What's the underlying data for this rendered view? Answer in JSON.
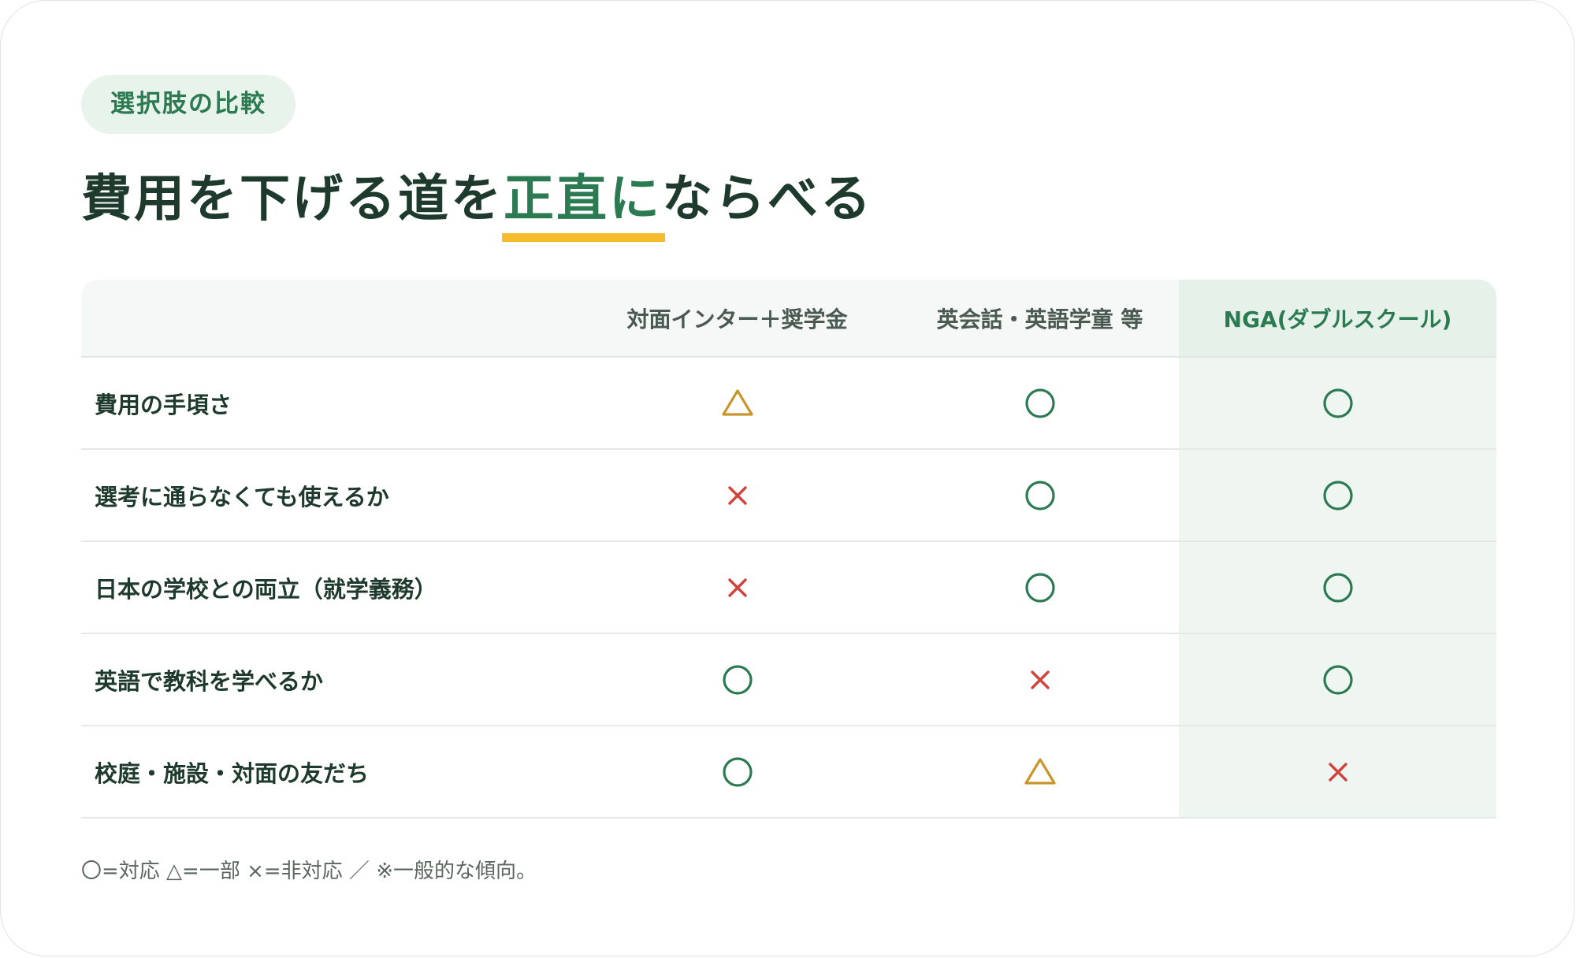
{
  "badge": "選択肢の比較",
  "title": {
    "before": "費用を下げる道を",
    "highlight": "正直に",
    "after": "ならべる"
  },
  "table": {
    "columns": [
      "",
      "対面インター＋奨学金",
      "英会話・英語学童 等",
      "NGA(ダブルスクール)"
    ],
    "rows": [
      {
        "label": "費用の手頃さ",
        "marks": [
          "triangle",
          "circle",
          "circle"
        ]
      },
      {
        "label": "選考に通らなくても使えるか",
        "marks": [
          "cross",
          "circle",
          "circle"
        ]
      },
      {
        "label": "日本の学校との両立（就学義務）",
        "marks": [
          "cross",
          "circle",
          "circle"
        ]
      },
      {
        "label": "英語で教科を学べるか",
        "marks": [
          "circle",
          "cross",
          "circle"
        ]
      },
      {
        "label": "校庭・施設・対面の友だち",
        "marks": [
          "circle",
          "triangle",
          "cross"
        ]
      }
    ]
  },
  "legend": "〇=対応 △=一部 ×=非対応 ／ ※一般的な傾向。",
  "colors": {
    "accent": "#2b7a52",
    "highlight_underline": "#f5bd2e",
    "circle": "#2b7a52",
    "triangle": "#c8962c",
    "cross": "#d0423b",
    "featured_column_bg": "#eff6f2"
  }
}
